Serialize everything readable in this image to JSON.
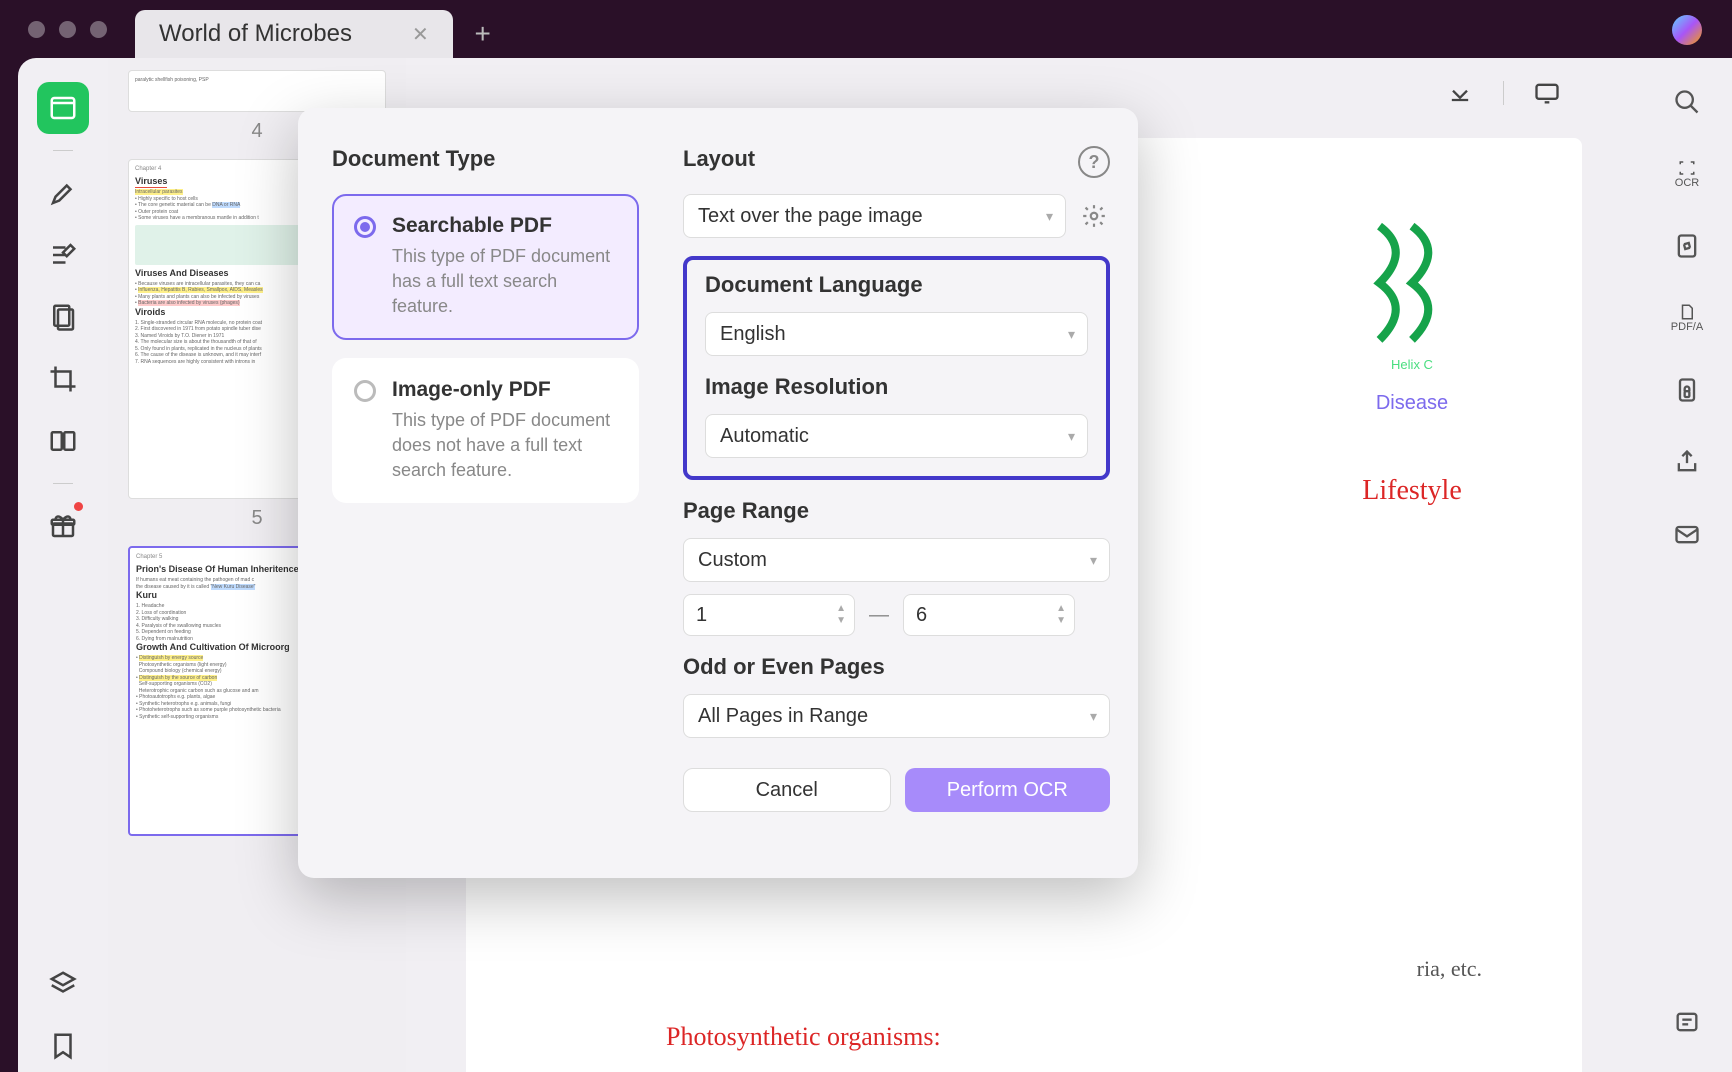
{
  "app": {
    "tab_title": "World of Microbes"
  },
  "thumbnails": {
    "pages": [
      {
        "num": "4",
        "chapter": "Chapter 4",
        "title": "Viruses",
        "sub1": "Viruses And Diseases",
        "sub2": "Viroids"
      },
      {
        "num": "5",
        "chapter": "Chapter 5",
        "title": "Prion's Disease Of Human Inheritence",
        "sub1": "Kuru",
        "sub2": "Growth And Cultivation Of Microorg"
      }
    ]
  },
  "dialog": {
    "left_title": "Document Type",
    "options": {
      "searchable": {
        "title": "Searchable PDF",
        "desc": "This type of PDF document has a full text search feature."
      },
      "image_only": {
        "title": "Image-only PDF",
        "desc": "This type of PDF document does not have a full text search feature."
      }
    },
    "layout": {
      "label": "Layout",
      "value": "Text over the page image"
    },
    "language": {
      "label": "Document Language",
      "value": "English"
    },
    "resolution": {
      "label": "Image Resolution",
      "value": "Automatic"
    },
    "page_range": {
      "label": "Page Range",
      "value": "Custom",
      "from": "1",
      "to": "6"
    },
    "odd_even": {
      "label": "Odd or Even Pages",
      "value": "All Pages in Range"
    },
    "cancel": "Cancel",
    "perform": "Perform OCR"
  },
  "document": {
    "helix_label": "Helix C",
    "disease": "Disease",
    "lifestyle": "Lifestyle",
    "etc": "ria, etc.",
    "photo": "Photosynthetic organisms:"
  },
  "right_icons": {
    "ocr": "OCR",
    "pdfa": "PDF/A"
  }
}
